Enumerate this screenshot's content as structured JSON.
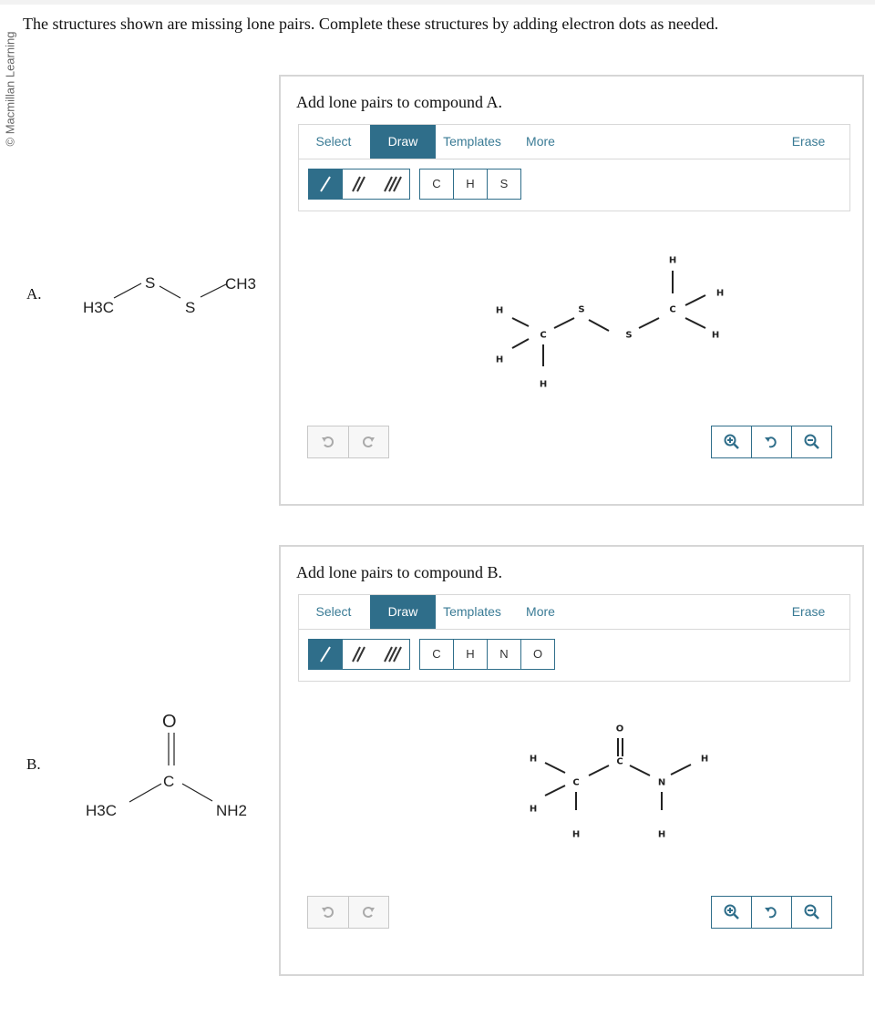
{
  "credit": "© Macmillan Learning",
  "instructions": "The structures shown are missing lone pairs. Complete these structures by adding electron dots as needed.",
  "items": [
    {
      "letter": "A.",
      "ref_atoms": {
        "left": "H3C",
        "s1": "S",
        "s2": "S",
        "right": "CH3"
      }
    },
    {
      "letter": "B.",
      "ref_atoms": {
        "o": "O",
        "c": "C",
        "left": "H3C",
        "right": "NH2"
      }
    }
  ],
  "panels": [
    {
      "title": "Add lone pairs to compound A.",
      "tabs": {
        "select": "Select",
        "draw": "Draw",
        "templates": "Templates",
        "more": "More",
        "erase": "Erase"
      },
      "atom_buttons": [
        "C",
        "H",
        "S"
      ],
      "molecule_labels": {
        "c1": "C",
        "h_a": "H",
        "h_b": "H",
        "h_c": "H",
        "s1": "S",
        "s2": "S",
        "c2": "C",
        "h_d": "H",
        "h_e": "H",
        "h_f": "H"
      }
    },
    {
      "title": "Add lone pairs to compound B.",
      "tabs": {
        "select": "Select",
        "draw": "Draw",
        "templates": "Templates",
        "more": "More",
        "erase": "Erase"
      },
      "atom_buttons": [
        "C",
        "H",
        "N",
        "O"
      ],
      "molecule_labels": {
        "o": "O",
        "c2": "C",
        "c1": "C",
        "h_a": "H",
        "h_b": "H",
        "h_c": "H",
        "n": "N",
        "h_d": "H",
        "h_e": "H"
      }
    }
  ],
  "colors": {
    "accent": "#2f6e8a",
    "link": "#3a7b95",
    "panel_border": "#d6d6d6"
  },
  "icons": [
    "single-bond-icon",
    "double-bond-icon",
    "triple-bond-icon",
    "undo-icon",
    "redo-icon",
    "zoom-in-icon",
    "reset-zoom-icon",
    "zoom-out-icon"
  ]
}
